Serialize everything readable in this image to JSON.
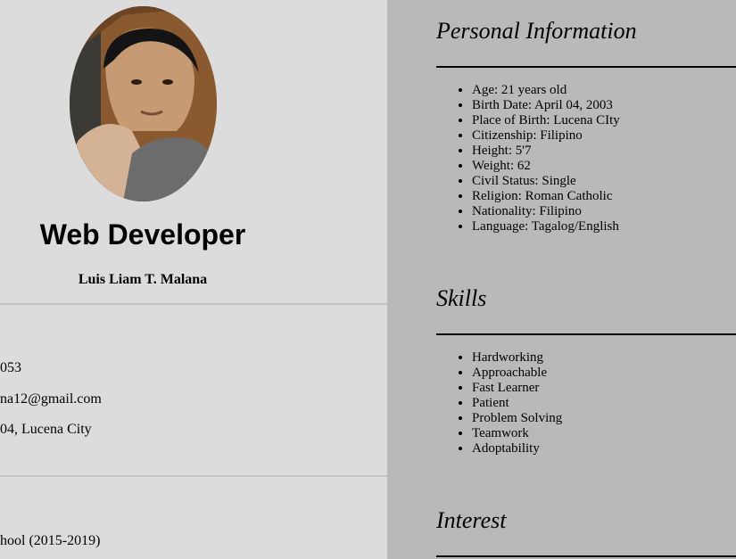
{
  "profile": {
    "title": "Web Developer",
    "name": "Luis Liam T. Malana"
  },
  "contact": {
    "phone_partial": "053",
    "email_partial": "na12@gmail.com",
    "address_partial": "04, Lucena City"
  },
  "education": {
    "line_partial": "hool (2015-2019)"
  },
  "sections": {
    "personal": {
      "heading": "Personal Information",
      "items": [
        "Age: 21 years old",
        "Birth Date: April 04, 2003",
        "Place of Birth: Lucena CIty",
        "Citizenship: Filipino",
        "Height: 5'7",
        "Weight: 62",
        "Civil Status: Single",
        "Religion: Roman Catholic",
        "Nationality: Filipino",
        "Language: Tagalog/English"
      ]
    },
    "skills": {
      "heading": "Skills",
      "items": [
        "Hardworking",
        "Approachable",
        "Fast Learner",
        "Patient",
        "Problem Solving",
        "Teamwork",
        "Adoptability"
      ]
    },
    "interest": {
      "heading": "Interest"
    }
  }
}
